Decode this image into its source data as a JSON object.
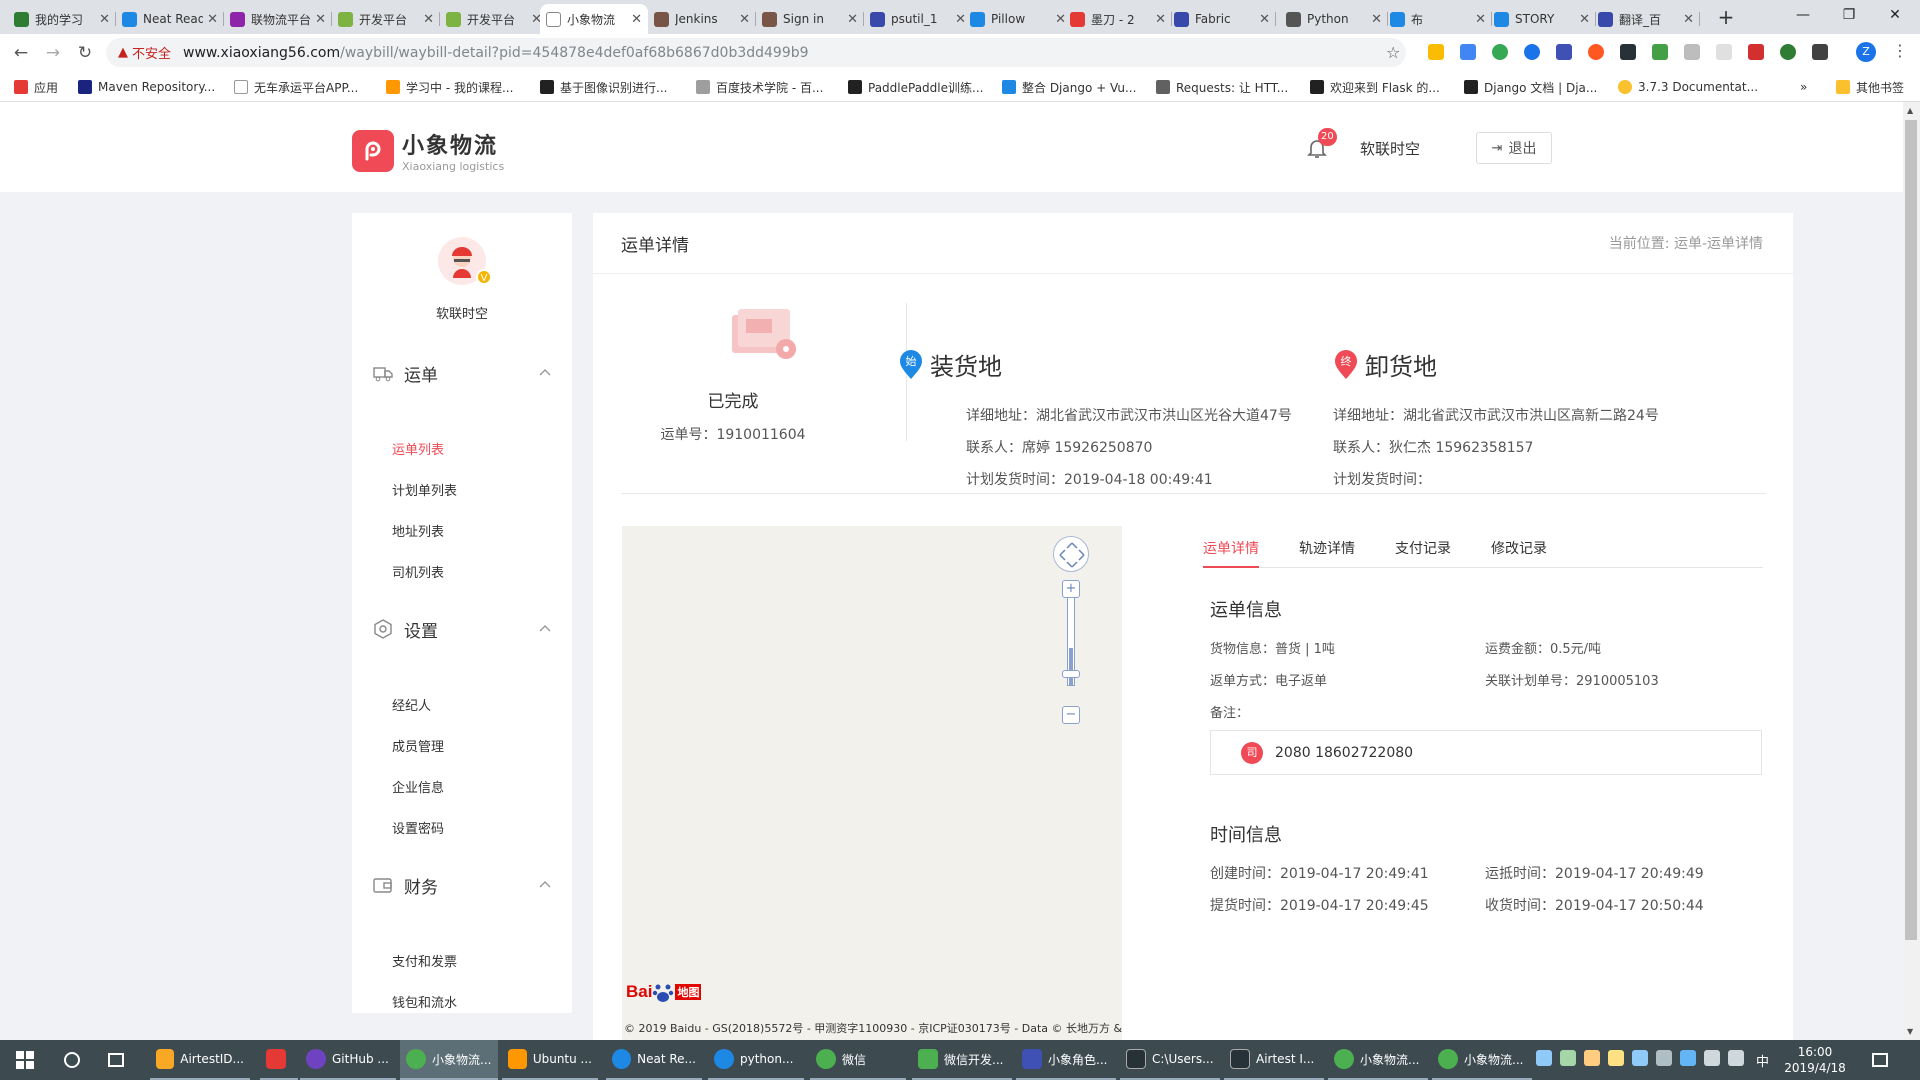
{
  "browser": {
    "tabs": [
      {
        "title": "我的学习",
        "color": "#2e7d32"
      },
      {
        "title": "Neat Reader",
        "color": "#1e88e5"
      },
      {
        "title": "联物流平台",
        "color": "#8e24aa"
      },
      {
        "title": "开发平台",
        "color": "#7cb342"
      },
      {
        "title": "开发平台",
        "color": "#7cb342"
      },
      {
        "title": "小象物流",
        "color": "#ffffff",
        "active": true
      },
      {
        "title": "Jenkins",
        "color": "#795548"
      },
      {
        "title": "Sign in",
        "color": "#795548"
      },
      {
        "title": "psutil_1",
        "color": "#3949ab"
      },
      {
        "title": "Pillow",
        "color": "#1e88e5"
      },
      {
        "title": "墨刀 - 2",
        "color": "#e53935"
      },
      {
        "title": "Fabric",
        "color": "#3949ab"
      },
      {
        "title": "Python",
        "color": "#555555"
      },
      {
        "title": "布",
        "color": "#1e88e5"
      },
      {
        "title": "STORY",
        "color": "#1e88e5"
      },
      {
        "title": "翻译_百",
        "color": "#3949ab"
      }
    ],
    "new_tab": "+",
    "window_controls": [
      "—",
      "❐",
      "✕"
    ],
    "address": {
      "security_label": "不安全",
      "host": "www.xiaoxiang56.com",
      "path": "/waybill/waybill-detail?pid=454878e4def0af68b6867d0b3dd499b9"
    },
    "profile_initial": "Z",
    "bookmarks": [
      {
        "label": "应用",
        "color": "#e53935"
      },
      {
        "label": "Maven Repository...",
        "color": "#1a237e"
      },
      {
        "label": "无车承运平台APP...",
        "color": "#9e9e9e"
      },
      {
        "label": "学习中 - 我的课程...",
        "color": "#ff9800"
      },
      {
        "label": "基于图像识别进行...",
        "color": "#212121"
      },
      {
        "label": "百度技术学院 - 百...",
        "color": "#9e9e9e"
      },
      {
        "label": "PaddlePaddle训练...",
        "color": "#212121"
      },
      {
        "label": "整合 Django + Vu...",
        "color": "#1e88e5"
      },
      {
        "label": "Requests: 让 HTT...",
        "color": "#616161"
      },
      {
        "label": "欢迎来到 Flask 的...",
        "color": "#212121"
      },
      {
        "label": "Django 文档 | Dja...",
        "color": "#212121"
      },
      {
        "label": "3.7.3 Documentat...",
        "color": "#fbc02d"
      }
    ],
    "bookmarks_more": "»",
    "other_bookmarks": "其他书签"
  },
  "header": {
    "logo_cn": "小象物流",
    "logo_en": "Xiaoxiang logistics",
    "notification_count": "20",
    "user_name": "软联时空",
    "logout_label": "退出"
  },
  "sidebar": {
    "user_name": "软联时空",
    "vip_badge": "V",
    "sections": [
      {
        "title": "运单",
        "items": [
          "运单列表",
          "计划单列表",
          "地址列表",
          "司机列表"
        ]
      },
      {
        "title": "设置",
        "items": [
          "经纪人",
          "成员管理",
          "企业信息",
          "设置密码"
        ]
      },
      {
        "title": "财务",
        "items": [
          "支付和发票",
          "钱包和流水"
        ]
      }
    ],
    "active_item": "运单列表"
  },
  "main": {
    "title": "运单详情",
    "breadcrumb": "当前位置: 运单-运单详情",
    "status": "已完成",
    "waybill_no": "运单号：1910011604",
    "loading": {
      "badge": "始",
      "title": "装货地",
      "address": "详细地址：湖北省武汉市武汉市洪山区光谷大道47号",
      "contact": "联系人：席婷 15926250870",
      "plan_time": "计划发货时间：2019-04-18 00:49:41"
    },
    "unloading": {
      "badge": "终",
      "title": "卸货地",
      "address": "详细地址：湖北省武汉市武汉市洪山区高新二路24号",
      "contact": "联系人：狄仁杰 15962358157",
      "plan_time": "计划发货时间："
    },
    "map": {
      "logo_bai": "Bai",
      "logo_du": "地图",
      "copyright": "© 2019 Baidu - GS(2018)5572号 - 甲测资字1100930 - 京ICP证030173号 - Data © 长地万方 &",
      "zoom_in": "+",
      "zoom_out": "−"
    },
    "tabs": [
      "运单详情",
      "轨迹详情",
      "支付记录",
      "修改记录"
    ],
    "active_tab": "运单详情",
    "waybill_info": {
      "title": "运单信息",
      "cargo": "货物信息：普货 | 1吨",
      "fee": "运费金额：0.5元/吨",
      "return_method": "返单方式：电子返单",
      "plan_no": "关联计划单号：2910005103",
      "remark_label": "备注：",
      "driver_badge": "司",
      "driver": "2080   18602722080"
    },
    "time_info": {
      "title": "时间信息",
      "created": "创建时间：2019-04-17 20:49:41",
      "arrived": "运抵时间：2019-04-17 20:49:49",
      "pickup": "提货时间：2019-04-17 20:49:45",
      "received": "收货时间：2019-04-17 20:50:44"
    }
  },
  "taskbar": {
    "items": [
      {
        "label": "AirtestID...",
        "color": "#f9a825"
      },
      {
        "label": "",
        "color": "#e53935"
      },
      {
        "label": "GitHub ...",
        "color": "#6f42c1"
      },
      {
        "label": "小象物流...",
        "color": "#4caf50",
        "active": true
      },
      {
        "label": "Ubuntu ...",
        "color": "#ff9800"
      },
      {
        "label": "Neat Re...",
        "color": "#1e88e5"
      },
      {
        "label": "python...",
        "color": "#1e88e5"
      },
      {
        "label": "微信",
        "color": "#4caf50"
      },
      {
        "label": "微信开发...",
        "color": "#4caf50"
      },
      {
        "label": "小象角色...",
        "color": "#3f51b5"
      },
      {
        "label": "C:\\Users...",
        "color": "#263238"
      },
      {
        "label": "Airtest I...",
        "color": "#263238"
      },
      {
        "label": "小象物流...",
        "color": "#4caf50"
      },
      {
        "label": "小象物流...",
        "color": "#4caf50"
      }
    ],
    "ime": "中",
    "time": "16:00",
    "date": "2019/4/18"
  }
}
